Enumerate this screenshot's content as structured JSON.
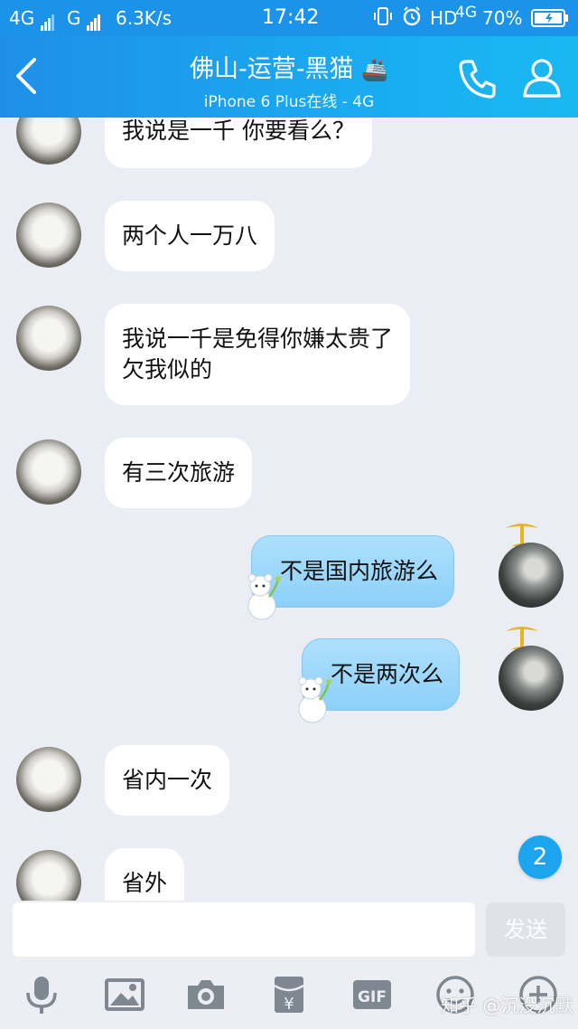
{
  "status_bar": {
    "carrier1": "4G",
    "carrier2": "G",
    "speed": "6.3K/s",
    "time": "17:42",
    "hd": "HD",
    "network": "4G",
    "battery": "70%"
  },
  "header": {
    "title": "佛山-运营-黑猫",
    "title_emoji": "🚢",
    "subtitle": "iPhone 6 Plus在线 - 4G"
  },
  "messages": [
    {
      "side": "left",
      "lines": [
        "我说是一千 你要看么？"
      ]
    },
    {
      "side": "left",
      "lines": [
        "两个人一万八"
      ]
    },
    {
      "side": "left",
      "lines": [
        "我说一千是免得你嫌太贵了",
        "欠我似的"
      ]
    },
    {
      "side": "left",
      "lines": [
        "有三次旅游"
      ]
    },
    {
      "side": "right",
      "lines": [
        "不是国内旅游么"
      ]
    },
    {
      "side": "right",
      "lines": [
        "不是两次么"
      ]
    },
    {
      "side": "left",
      "lines": [
        "省内一次"
      ]
    },
    {
      "side": "left",
      "lines": [
        "省外"
      ]
    }
  ],
  "unread_count": "2",
  "input": {
    "value": "",
    "placeholder": ""
  },
  "send_label": "发送",
  "toolbar": {
    "icons": [
      "microphone-icon",
      "image-icon",
      "camera-icon",
      "red-packet-icon",
      "gif-icon",
      "emoji-icon",
      "plus-icon"
    ],
    "gif_label": "GIF",
    "red_packet_symbol": "¥"
  },
  "watermark": "知乎 @沉没沉默",
  "colors": {
    "header": "#1aa8ef",
    "accent": "#1ca4ef",
    "bubble_mine": "#9ed8fb",
    "background": "#eaedf4"
  }
}
